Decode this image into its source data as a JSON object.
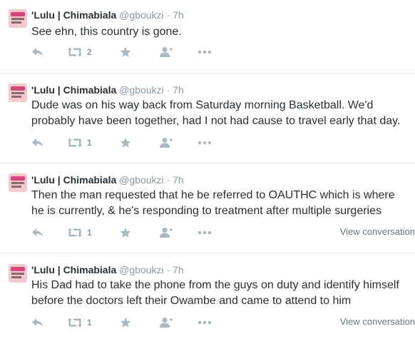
{
  "tweets": [
    {
      "name": "'Lulu | Chimabiala",
      "handle": "@gboukzi",
      "dot": "·",
      "time": "7h",
      "text": "See ehn, this country is gone.",
      "retweets": "2",
      "view_conversation": ""
    },
    {
      "name": "'Lulu | Chimabiala",
      "handle": "@gboukzi",
      "dot": "·",
      "time": "7h",
      "text": "Dude was on his way back from Saturday morning Basketball. We'd probably have been together, had I not had cause to travel early that day.",
      "retweets": "1",
      "view_conversation": ""
    },
    {
      "name": "'Lulu | Chimabiala",
      "handle": "@gboukzi",
      "dot": "·",
      "time": "7h",
      "text": "Then the man requested that he be referred to OAUTHC which is where he is currently, & he's responding to treatment after multiple surgeries",
      "retweets": "1",
      "view_conversation": "View conversation"
    },
    {
      "name": "'Lulu | Chimabiala",
      "handle": "@gboukzi",
      "dot": "·",
      "time": "7h",
      "text": "His Dad had to take the phone from the guys on duty and identify himself before the doctors left their Owambe and came to attend to him",
      "retweets": "1",
      "view_conversation": "View conversation"
    }
  ],
  "icons": {
    "reply": "reply-icon",
    "retweet": "retweet-icon",
    "favorite": "star-icon",
    "follow": "follow-icon",
    "more": "more-icon"
  },
  "colors": {
    "text": "#292f33",
    "muted": "#8899a6",
    "action_icon": "#aab8c2",
    "divider": "#e1e8ed"
  }
}
